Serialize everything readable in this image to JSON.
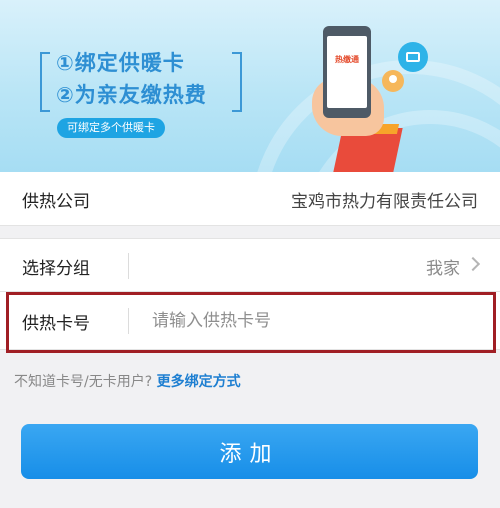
{
  "banner": {
    "line1": "①绑定供暖卡",
    "line2": "②为亲友缴热费",
    "pill": "可绑定多个供暖卡",
    "phone_logo": "热缴通"
  },
  "company": {
    "label": "供热公司",
    "value": "宝鸡市热力有限责任公司"
  },
  "group": {
    "label": "选择分组",
    "value": "我家"
  },
  "card": {
    "label": "供热卡号",
    "placeholder": "请输入供热卡号",
    "value": ""
  },
  "hint": {
    "text": "不知道卡号/无卡用户?",
    "link": "更多绑定方式"
  },
  "add_button": {
    "label": "添加"
  },
  "colors": {
    "accent": "#1e90e8",
    "highlight": "#a01e24",
    "link": "#1e7fd1"
  }
}
